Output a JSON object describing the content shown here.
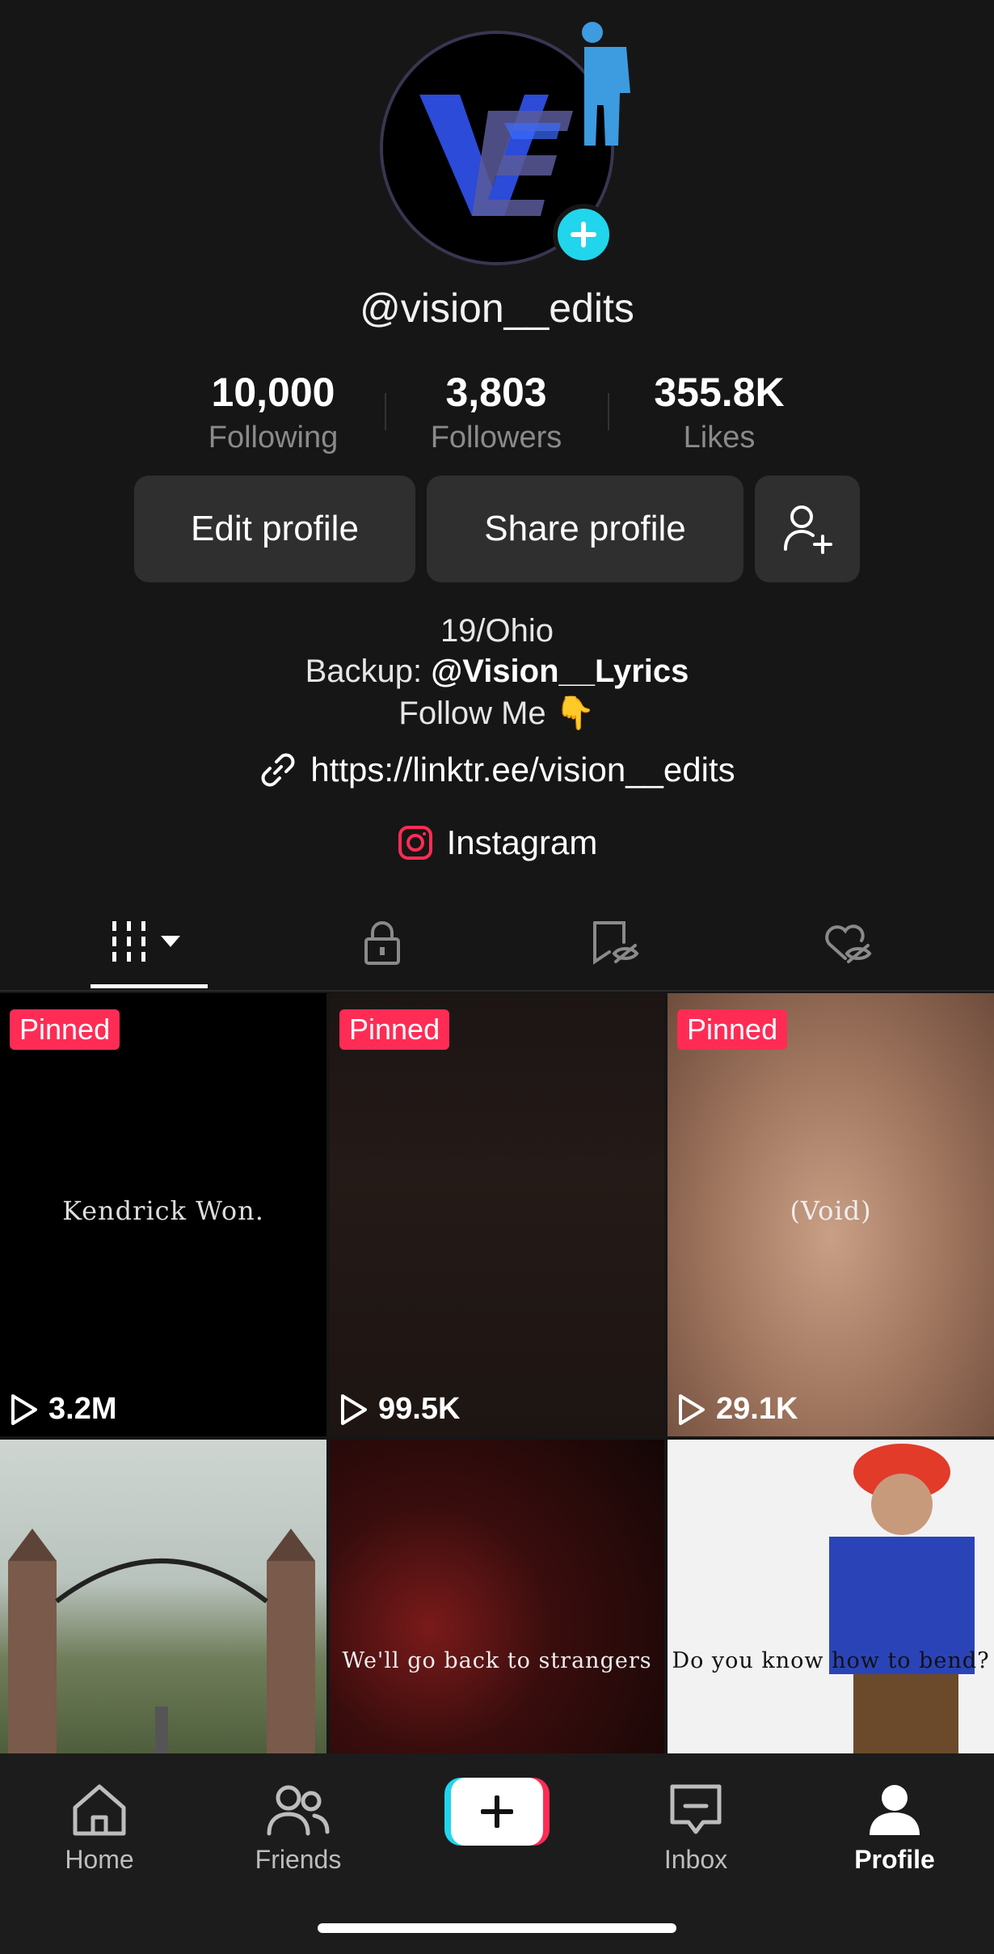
{
  "profile": {
    "username": "@vision__edits",
    "stats": [
      {
        "value": "10,000",
        "label": "Following"
      },
      {
        "value": "3,803",
        "label": "Followers"
      },
      {
        "value": "355.8K",
        "label": "Likes"
      }
    ],
    "buttons": {
      "edit": "Edit profile",
      "share": "Share profile"
    },
    "bio": {
      "line1": "19/Ohio",
      "line2_prefix": "Backup: ",
      "line2_handle": "@Vision__Lyrics",
      "line3": "Follow Me 👇"
    },
    "link": "https://linktr.ee/vision__edits",
    "instagram": "Instagram"
  },
  "tabs": [
    {
      "icon": "grid-icon",
      "active": true
    },
    {
      "icon": "lock-icon",
      "active": false
    },
    {
      "icon": "hidden-saved-icon",
      "active": false
    },
    {
      "icon": "hidden-liked-icon",
      "active": false
    }
  ],
  "videos": [
    {
      "pinned": "Pinned",
      "views": "3.2M",
      "caption": "Kendrick Won."
    },
    {
      "pinned": "Pinned",
      "views": "99.5K",
      "caption": ""
    },
    {
      "pinned": "Pinned",
      "views": "29.1K",
      "caption": "(Void)"
    },
    {
      "pinned": "",
      "views": "",
      "caption": ""
    },
    {
      "pinned": "",
      "views": "",
      "caption": "We'll go back to strangers"
    },
    {
      "pinned": "",
      "views": "",
      "caption": "Do you know how to bend?"
    }
  ],
  "nav": {
    "home": "Home",
    "friends": "Friends",
    "inbox": "Inbox",
    "profile": "Profile"
  },
  "colors": {
    "accent_red": "#fe2c55",
    "accent_cyan": "#20d5ec",
    "background": "#161616"
  }
}
